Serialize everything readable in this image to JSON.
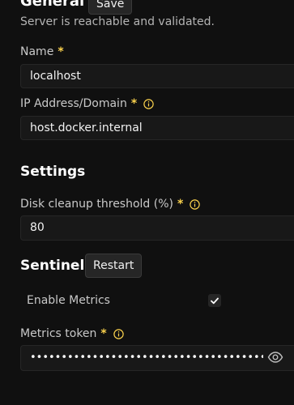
{
  "general": {
    "title": "General",
    "save_label": "Save",
    "subtitle": "Server is reachable and validated."
  },
  "fields": {
    "name": {
      "label": "Name",
      "required": "*",
      "value": "localhost"
    },
    "ip": {
      "label": "IP Address/Domain",
      "required": "*",
      "value": "host.docker.internal"
    }
  },
  "settings": {
    "title": "Settings",
    "disk": {
      "label": "Disk cleanup threshold (%)",
      "required": "*",
      "value": "80"
    }
  },
  "sentinel": {
    "title": "Sentinel",
    "restart_label": "Restart",
    "enable_metrics": {
      "label": "Enable Metrics",
      "checked": true
    },
    "metrics_token": {
      "label": "Metrics token",
      "required": "*",
      "masked_value": "•••••••••••••••••••••••••••••••••••••••••••••"
    }
  },
  "colors": {
    "background": "#101010",
    "input_bg": "#181818",
    "required_accent": "#fcd34d",
    "info_accent": "#fcd34d"
  },
  "icons": {
    "info": "info-icon",
    "check": "check-icon",
    "eye": "eye-icon"
  }
}
